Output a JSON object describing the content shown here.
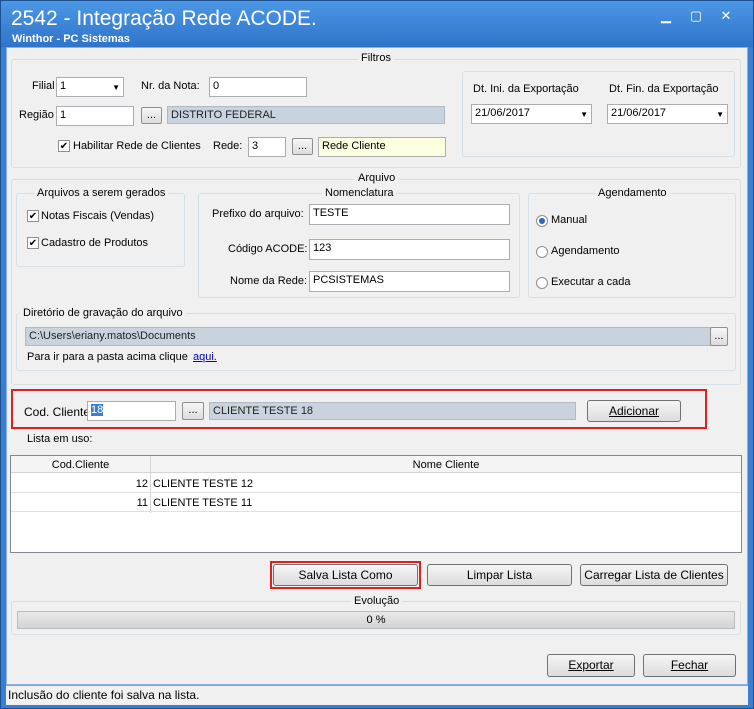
{
  "window": {
    "title": "2542 - Integração Rede ACODE.",
    "subtitle": "Winthor - PC Sistemas",
    "controls": [
      "▁",
      "▢",
      "✕"
    ]
  },
  "filtros": {
    "title": "Filtros",
    "filial_label": "Filial",
    "filial_value": "1",
    "nota_label": "Nr. da Nota:",
    "nota_value": "0",
    "regiao_label": "Região",
    "regiao_value": "1",
    "regiao_btn": "...",
    "regiao_desc": "DISTRITO FEDERAL",
    "habilitar_label": "Habilitar Rede de Clientes",
    "rede_label": "Rede:",
    "rede_value": "3",
    "rede_btn": "...",
    "rede_desc": "Rede Cliente",
    "dt_ini_label": "Dt. Ini. da Exportação",
    "dt_ini_value": "21/06/2017",
    "dt_fin_label": "Dt. Fin. da Exportação",
    "dt_fin_value": "21/06/2017"
  },
  "arquivo": {
    "title": "Arquivo",
    "gerados_title": "Arquivos a serem gerados",
    "notas_label": "Notas Fiscais  (Vendas)",
    "cadastro_label": "Cadastro de Produtos",
    "nomenclatura_title": "Nomenclatura",
    "prefixo_label": "Prefixo do arquivo:",
    "prefixo_value": "TESTE",
    "codigo_label": "Código ACODE:",
    "codigo_value": "123",
    "nome_rede_label": "Nome da Rede:",
    "nome_rede_value": "PCSISTEMAS",
    "agendamento_title": "Agendamento",
    "opt_manual": "Manual",
    "opt_agendamento": "Agendamento",
    "opt_executar": "Executar a cada",
    "diretorio_title": "Diretório de gravação do arquivo",
    "diretorio_value": "C:\\Users\\eriany.matos\\Documents",
    "diretorio_btn": "...",
    "pasta_text": "Para ir para a pasta acima clique",
    "pasta_link": "aqui."
  },
  "cliente": {
    "cod_label": "Cod. Cliente",
    "cod_value": "18",
    "cod_btn": "...",
    "desc_value": "CLIENTE TESTE 18",
    "adicionar": "Adicionar",
    "lista_label": "Lista em uso:"
  },
  "table": {
    "columns": [
      "Cod.Cliente",
      "Nome Cliente"
    ],
    "rows": [
      {
        "cod": "12",
        "nome": "CLIENTE TESTE 12"
      },
      {
        "cod": "11",
        "nome": "CLIENTE TESTE 11"
      }
    ]
  },
  "actions": {
    "salva": "Salva Lista Como",
    "limpar": "Limpar Lista",
    "carregar": "Carregar Lista de Clientes"
  },
  "evolucao": {
    "title": "Evolução",
    "progress_text": "0 %",
    "progress_value": 0
  },
  "footer": {
    "exportar": "Exportar",
    "fechar": "Fechar",
    "status": "Inclusão do cliente foi salva na lista."
  }
}
